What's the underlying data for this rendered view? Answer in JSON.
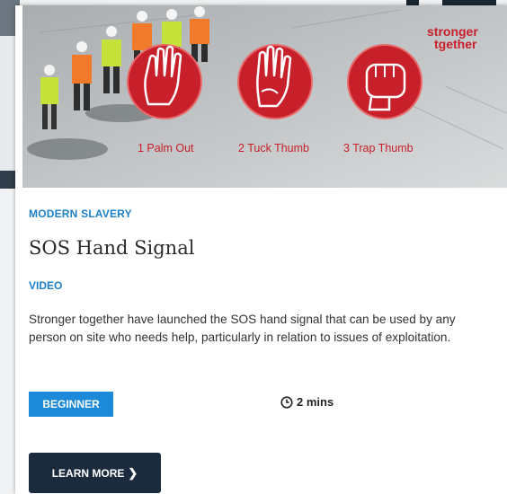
{
  "hero": {
    "brand_line1": "stronger",
    "brand_line2": "tgether",
    "steps": [
      {
        "label": "1 Palm Out"
      },
      {
        "label": "2 Tuck Thumb"
      },
      {
        "label": "3 Trap Thumb"
      }
    ]
  },
  "card": {
    "category": "MODERN SLAVERY",
    "title": "SOS Hand Signal",
    "type": "VIDEO",
    "description": "Stronger together have launched the SOS hand signal that can be used by any person on site who needs help, particularly in relation to issues of exploitation.",
    "level": "BEGINNER",
    "duration": "2 mins",
    "cta_label": "LEARN MORE",
    "cta_icon": "chevron-right-icon"
  },
  "colors": {
    "accent_blue": "#1c8ad8",
    "link_blue": "#1e7fc4",
    "button_navy": "#1b2b3d",
    "circle_red": "#c8202b"
  }
}
